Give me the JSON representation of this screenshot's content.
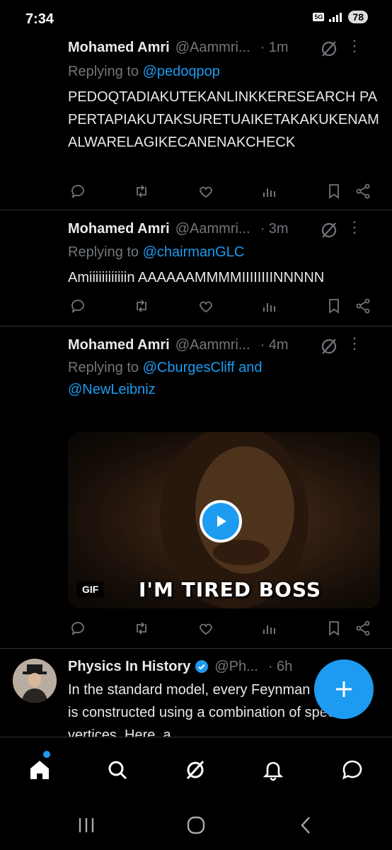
{
  "status_bar": {
    "time": "7:34",
    "network": "5G",
    "battery": "78"
  },
  "tweets": [
    {
      "name": "Mohamed Amri",
      "handle": "@Aammri...",
      "time": "· 1m",
      "replying_prefix": "Replying to ",
      "replying_to": "@pedoqpop",
      "text": "PEDOQTADIAKUTEKANLINKKERESEARCH PAPERTAPIAKUTAKSURETUAIKETAKAKUKENAMALWARELAGIKECANENAKCHECK"
    },
    {
      "name": "Mohamed Amri",
      "handle": "@Aammri...",
      "time": "· 3m",
      "replying_prefix": "Replying to ",
      "replying_to": "@chairmanGLC",
      "text": "Amiiiiiiiiiiiin AAAAAAMMMMIIIIIIIINNNNN"
    },
    {
      "name": "Mohamed Amri",
      "handle": "@Aammri...",
      "time": "· 4m",
      "replying_prefix": "Replying to ",
      "replying_to": "@CburgesCliff and @NewLeibniz",
      "media": {
        "badge": "GIF",
        "caption": "I'M TIRED BOSS"
      }
    },
    {
      "name": "Physics In History",
      "handle": "@Ph...",
      "time": "· 6h",
      "text": "In the standard model, every Feynman diagram is constructed using a combination of specific vertices. Here, a"
    }
  ],
  "icons": {
    "reply": "reply-icon",
    "retweet": "retweet-icon",
    "like": "heart-icon",
    "views": "views-icon",
    "bookmark": "bookmark-icon",
    "share": "share-icon",
    "grok": "grok-icon",
    "more": "more-icon"
  },
  "colors": {
    "accent": "#1d9bf0",
    "text": "#e7e9ea",
    "muted": "#71767b",
    "divider": "#2f3336"
  },
  "fab_label": "+",
  "bottom_nav": [
    "home",
    "search",
    "grok",
    "notifications",
    "messages"
  ]
}
